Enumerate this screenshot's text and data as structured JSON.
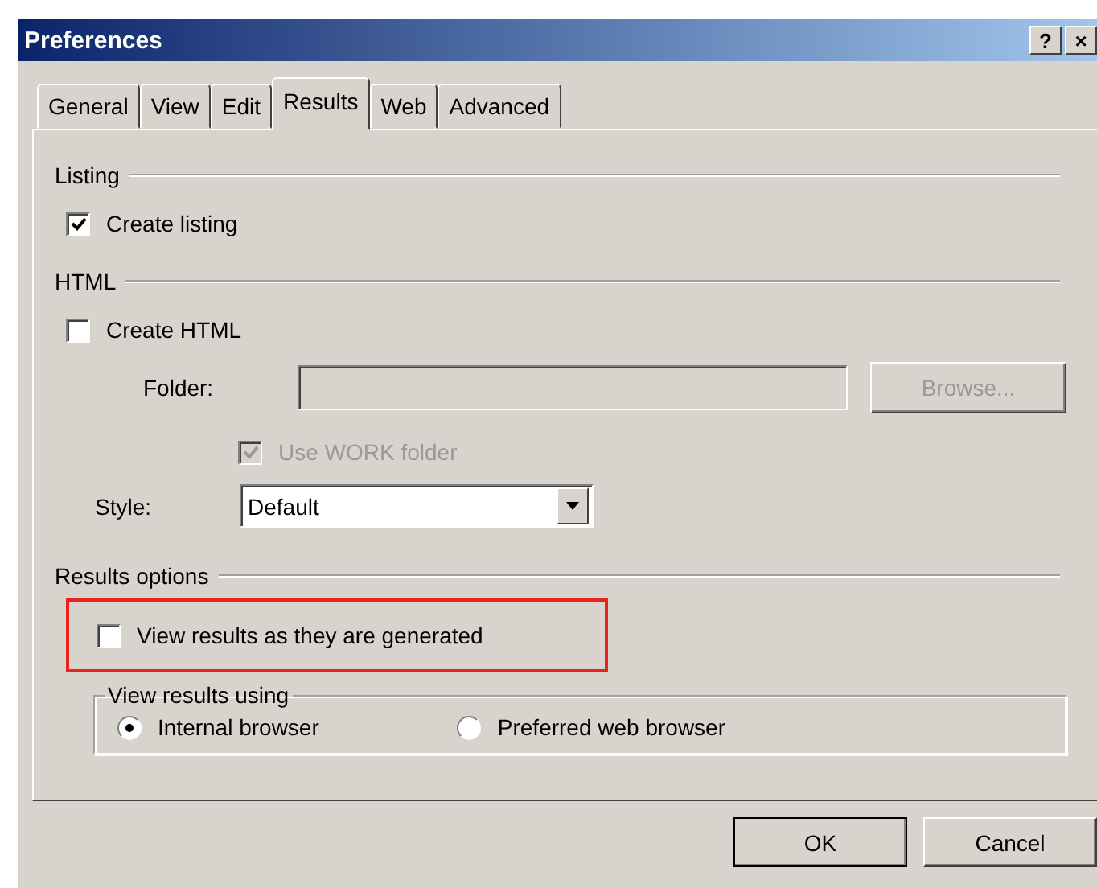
{
  "window": {
    "title": "Preferences",
    "title_buttons": [
      "?",
      "×"
    ]
  },
  "tabs": [
    {
      "label": "General",
      "selected": false
    },
    {
      "label": "View",
      "selected": false
    },
    {
      "label": "Edit",
      "selected": false
    },
    {
      "label": "Results",
      "selected": true
    },
    {
      "label": "Web",
      "selected": false
    },
    {
      "label": "Advanced",
      "selected": false
    }
  ],
  "listing": {
    "heading": "Listing",
    "create_listing": {
      "label": "Create listing",
      "checked": true
    }
  },
  "html": {
    "heading": "HTML",
    "create_html": {
      "label": "Create HTML",
      "checked": false
    },
    "folder": {
      "label": "Folder:",
      "disabled": true
    },
    "browse": {
      "label": "Browse...",
      "disabled": true
    },
    "use_work_folder": {
      "label": "Use WORK folder",
      "checked": true,
      "disabled": true
    },
    "style": {
      "label": "Style:",
      "value": "Default"
    }
  },
  "results_options": {
    "heading": "Results options",
    "view_results": {
      "label": "View results as they are generated",
      "checked": false,
      "highlighted": true
    },
    "view_using": {
      "heading": "View results using",
      "options": [
        {
          "label": "Internal browser",
          "selected": true
        },
        {
          "label": "Preferred web browser",
          "selected": false
        }
      ]
    }
  },
  "buttons": [
    {
      "label": "OK",
      "default": true
    },
    {
      "label": "Cancel",
      "default": false
    }
  ]
}
